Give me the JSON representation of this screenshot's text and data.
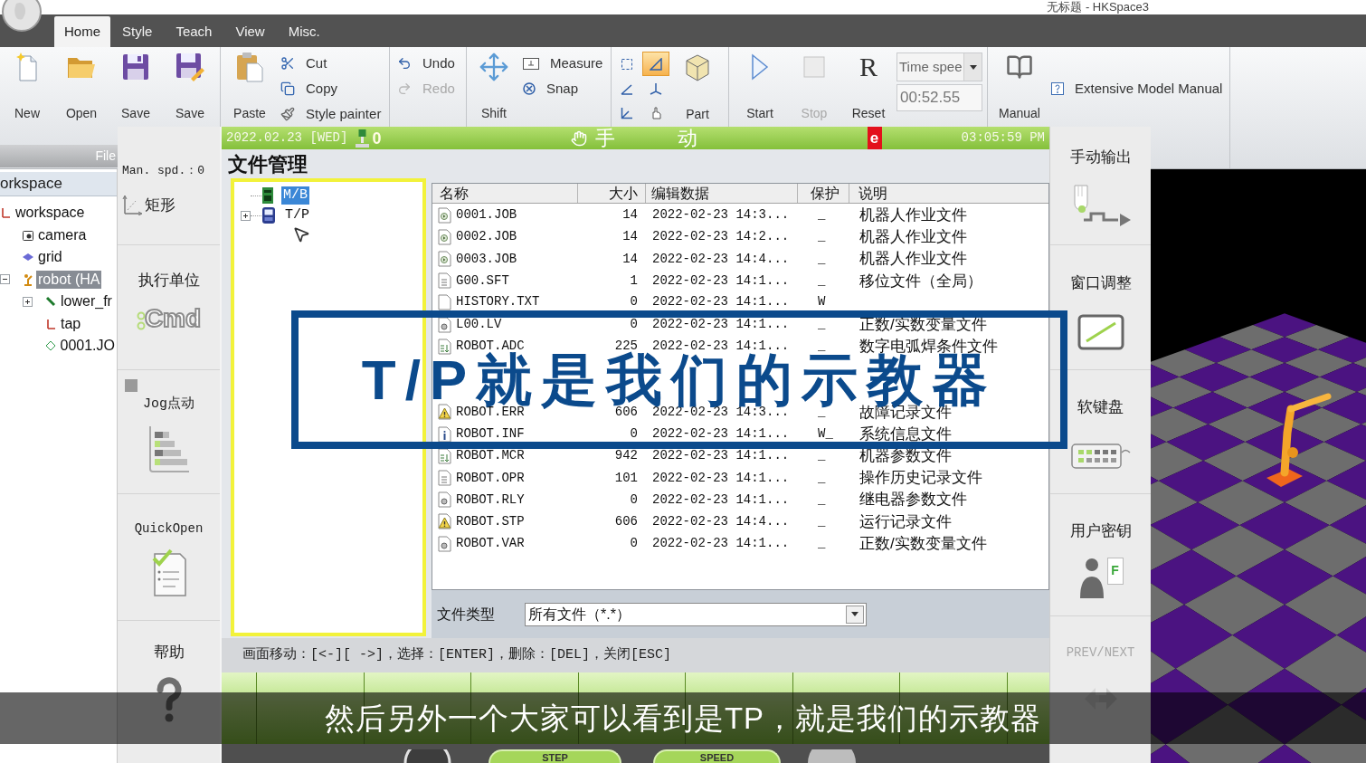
{
  "window": {
    "title": "无标题 - HKSpace3"
  },
  "tabs": [
    {
      "label": "Home",
      "selected": true
    },
    {
      "label": "Style",
      "selected": false
    },
    {
      "label": "Teach",
      "selected": false
    },
    {
      "label": "View",
      "selected": false
    },
    {
      "label": "Misc.",
      "selected": false
    }
  ],
  "ribbon": {
    "file_group": {
      "label": "File",
      "buttons": [
        {
          "label": "New"
        },
        {
          "label": "Open"
        },
        {
          "label": "Save"
        },
        {
          "label": "Save"
        }
      ]
    },
    "clipboard_group": {
      "large": {
        "label": "Paste"
      },
      "small": [
        {
          "label": "Cut"
        },
        {
          "label": "Copy"
        },
        {
          "label": "Style painter"
        }
      ]
    },
    "history_group": {
      "small": [
        {
          "label": "Undo",
          "disabled": false
        },
        {
          "label": "Redo",
          "disabled": true
        }
      ]
    },
    "transform_group": {
      "large": {
        "label": "Shift"
      },
      "small": [
        {
          "label": "Measure"
        },
        {
          "label": "Snap"
        }
      ]
    },
    "view_group": {
      "tools": [
        {
          "selected": false
        },
        {
          "selected": true
        },
        {
          "selected": false
        },
        {
          "selected": false
        },
        {
          "selected": false
        },
        {
          "selected": false
        }
      ],
      "large": {
        "label": "Part"
      }
    },
    "simulation_group": {
      "buttons": [
        {
          "label": "Start",
          "disabled": false
        },
        {
          "label": "Stop",
          "disabled": true
        },
        {
          "label": "Reset",
          "disabled": false,
          "glyph": "R"
        }
      ],
      "time_speed": {
        "label": "Time spee"
      },
      "time": {
        "value": "00:52.55"
      }
    },
    "manual_group": {
      "large": {
        "label": "Manual"
      },
      "small": [
        {
          "label": "Extensive Model Manual"
        }
      ]
    }
  },
  "workspace_panel": {
    "title": "orkspace",
    "tree": [
      {
        "label": "workspace",
        "kind": "frame",
        "selected": false,
        "children": [
          {
            "label": "camera",
            "kind": "camera",
            "selected": false
          },
          {
            "label": "grid",
            "kind": "grid",
            "selected": false
          },
          {
            "label": "robot (HA",
            "kind": "robot",
            "selected": true,
            "expanded": true,
            "children": [
              {
                "label": "lower_fr",
                "kind": "link",
                "selected": false,
                "expanded": false
              },
              {
                "label": "tap",
                "kind": "frame",
                "selected": false
              },
              {
                "label": "0001.JO",
                "kind": "job",
                "selected": false
              }
            ]
          }
        ]
      }
    ]
  },
  "tp": {
    "header": {
      "date": "2022.02.23 [WED]",
      "count": "0",
      "mode": "手 动",
      "alert": "e",
      "time": "03:05:59 PM"
    },
    "left_sidebar": {
      "speed": "Man. spd.：0",
      "items": [
        {
          "label": "矩形"
        },
        {
          "label": "执行单位",
          "icon_text": "Cmd"
        },
        {
          "label": "Jog点动"
        },
        {
          "label": "QuickOpen"
        },
        {
          "label": "帮助"
        }
      ]
    },
    "title": "文件管理",
    "tree": [
      {
        "label": "M/B",
        "selected": true
      },
      {
        "label": "T/P",
        "selected": false,
        "expanded": false
      }
    ],
    "table": {
      "columns": [
        "名称",
        "大小",
        "编辑数据",
        "保护",
        "说明"
      ],
      "rows": [
        {
          "kind": "job",
          "name": "0001.JOB",
          "size": "14",
          "date": "2022-02-23 14:3...",
          "protect": "_",
          "description": "机器人作业文件"
        },
        {
          "kind": "job",
          "name": "0002.JOB",
          "size": "14",
          "date": "2022-02-23 14:2...",
          "protect": "_",
          "description": "机器人作业文件"
        },
        {
          "kind": "job",
          "name": "0003.JOB",
          "size": "14",
          "date": "2022-02-23 14:4...",
          "protect": "_",
          "description": "机器人作业文件"
        },
        {
          "kind": "list",
          "name": "G00.SFT",
          "size": "1",
          "date": "2022-02-23 14:1...",
          "protect": "_",
          "description": "移位文件（全局）"
        },
        {
          "kind": "text",
          "name": "HISTORY.TXT",
          "size": "0",
          "date": "2022-02-23 14:1...",
          "protect": "W"
        },
        {
          "kind": "data",
          "name": "L00.LV",
          "size": "0",
          "date": "2022-02-23 14:1...",
          "protect": "_",
          "description": "正数/实数变量文件"
        },
        {
          "kind": "param",
          "name": "ROBOT.ADC",
          "size": "225",
          "date": "2022-02-23 14:1...",
          "protect": "_",
          "description": "数字电弧焊条件文件"
        },
        {
          "kind": "covered"
        },
        {
          "kind": "covered"
        },
        {
          "kind": "warning",
          "name": "ROBOT.ERR",
          "size": "606",
          "date": "2022-02-23 14:3...",
          "protect": "_",
          "description": "故障记录文件"
        },
        {
          "kind": "info",
          "name": "ROBOT.INF",
          "size": "0",
          "date": "2022-02-23 14:1...",
          "protect": "W_",
          "description": "系统信息文件"
        },
        {
          "kind": "param",
          "name": "ROBOT.MCR",
          "size": "942",
          "date": "2022-02-23 14:1...",
          "protect": "_",
          "description": "机器参数文件"
        },
        {
          "kind": "list",
          "name": "ROBOT.OPR",
          "size": "101",
          "date": "2022-02-23 14:1...",
          "protect": "_",
          "description": "操作历史记录文件"
        },
        {
          "kind": "data",
          "name": "ROBOT.RLY",
          "size": "0",
          "date": "2022-02-23 14:1...",
          "protect": "_",
          "description": "继电器参数文件"
        },
        {
          "kind": "warning",
          "name": "ROBOT.STP",
          "size": "606",
          "date": "2022-02-23 14:4...",
          "protect": "_",
          "description": "运行记录文件"
        },
        {
          "kind": "data",
          "name": "ROBOT.VAR",
          "size": "0",
          "date": "2022-02-23 14:1...",
          "protect": "_",
          "description": "正数/实数变量文件"
        }
      ]
    },
    "file_type": {
      "label": "文件类型",
      "value": "所有文件（*.*）"
    },
    "hint": "画面移动：[<-][ ->]，选择：[ENTER]，删除：[DEL]，关闭[ESC]",
    "bottom_controls": [
      {
        "label": "STEP"
      },
      {
        "label": "SPEED"
      }
    ],
    "right_sidebar": {
      "items": [
        {
          "label": "手动输出",
          "disabled": false
        },
        {
          "label": "窗口调整",
          "disabled": false
        },
        {
          "label": "软键盘",
          "disabled": false
        },
        {
          "label": "用户密钥",
          "disabled": false,
          "icon_text": "F"
        },
        {
          "label": "PREV/NEXT",
          "disabled": true
        }
      ]
    }
  },
  "annotation": {
    "text": "T/P就是我们的示教器"
  },
  "subtitle": "然后另外一个大家可以看到是TP，就是我们的示教器"
}
